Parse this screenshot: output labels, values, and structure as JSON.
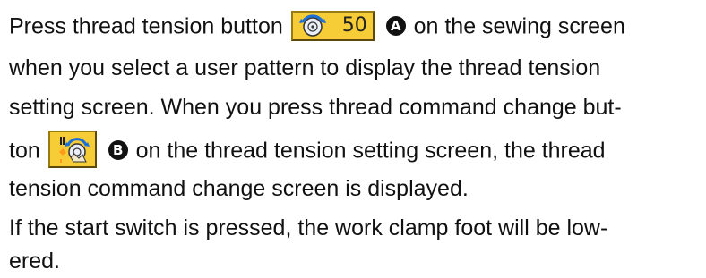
{
  "lines": {
    "l1_pre": "Press thread tension button",
    "l1_post": "on the sewing screen",
    "l2": "when you select a user pattern to display the thread tension",
    "l3": "setting screen. When you press thread command change but-",
    "l4_pre": "ton",
    "l4_post": "on the thread tension setting screen, the thread",
    "l5": "tension command change screen is displayed.",
    "l6": "If the start switch is pressed, the work clamp foot will be low-",
    "l7": "ered."
  },
  "buttons": {
    "thread_tension": {
      "icon": "thread-tension-icon",
      "value": "50"
    },
    "thread_command_change": {
      "icon": "thread-command-change-icon"
    }
  },
  "markers": {
    "a": "A",
    "b": "B"
  },
  "colors": {
    "button_fill": "#f6cc37",
    "icon_blue": "#1a6fd8",
    "text": "#111111"
  }
}
